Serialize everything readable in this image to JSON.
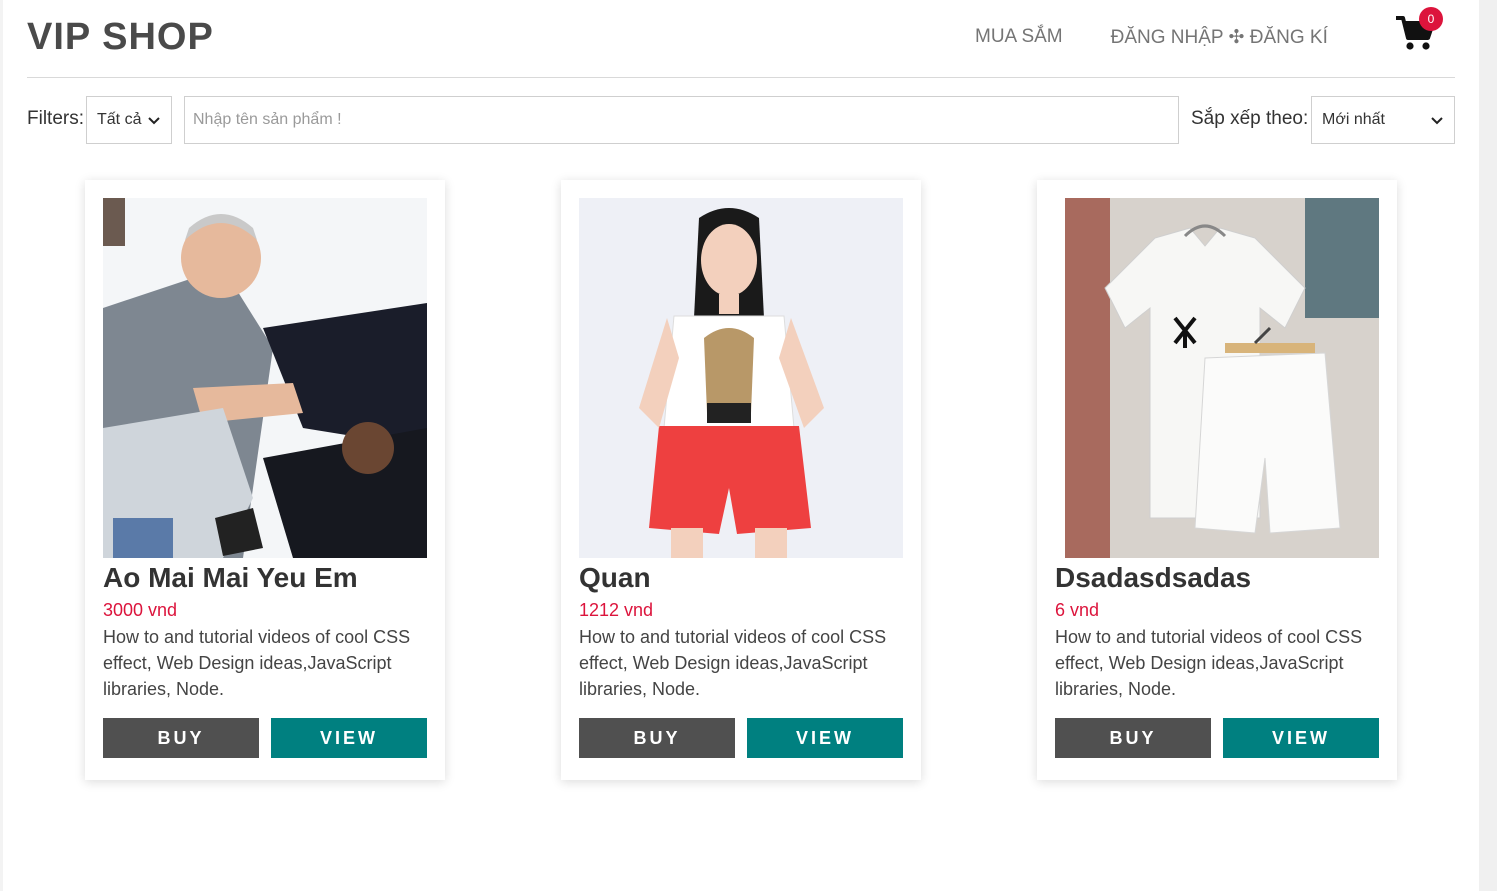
{
  "header": {
    "logo": "VIP SHOP",
    "nav": [
      "MUA SẮM",
      "ĐĂNG NHẬP ✣ ĐĂNG KÍ"
    ],
    "cart_count": "0"
  },
  "filters": {
    "label": "Filters:",
    "category_value": "Tất cả",
    "search_placeholder": "Nhập tên sản phẩm !",
    "sort_label": "Sắp xếp theo:",
    "sort_value": "Mới nhất"
  },
  "products": [
    {
      "name": "Ao Mai Mai Yeu Em",
      "price": "3000 vnd",
      "description": "How to and tutorial videos of cool CSS effect, Web Design ideas,JavaScript libraries, Node.",
      "buy_label": "BUY",
      "view_label": "VIEW"
    },
    {
      "name": "Quan",
      "price": "1212 vnd",
      "description": "How to and tutorial videos of cool CSS effect, Web Design ideas,JavaScript libraries, Node.",
      "buy_label": "BUY",
      "view_label": "VIEW"
    },
    {
      "name": "Dsadasdsadas",
      "price": "6 vnd",
      "description": "How to and tutorial videos of cool CSS effect, Web Design ideas,JavaScript libraries, Node.",
      "buy_label": "BUY",
      "view_label": "VIEW"
    }
  ],
  "colors": {
    "accent_teal": "#008080",
    "buy_gray": "#505050",
    "price_red": "#dc143c"
  }
}
